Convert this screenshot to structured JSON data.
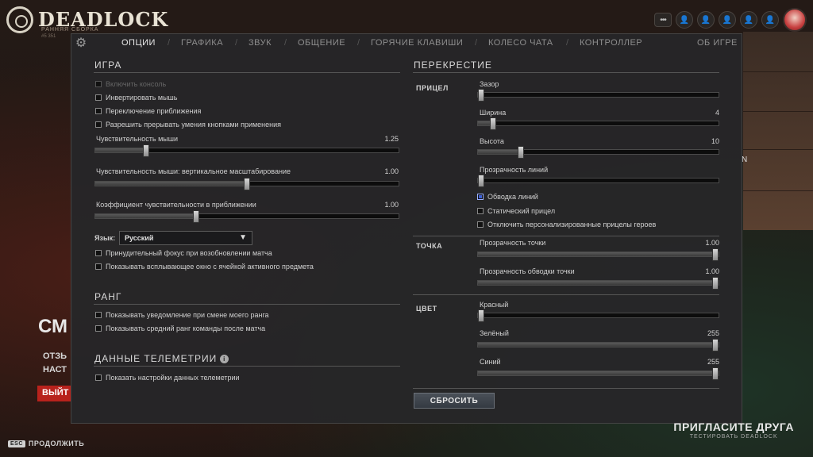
{
  "brand": {
    "name": "DEADLOCK",
    "subtitle": "РАННЯЯ СБОРКА",
    "version": "#5 351"
  },
  "topbar": {
    "menu_label": "•••"
  },
  "tabs": [
    {
      "label": "ОПЦИИ"
    },
    {
      "label": "ГРАФИКА"
    },
    {
      "label": "ЗВУК"
    },
    {
      "label": "ОБЩЕНИЕ"
    },
    {
      "label": "ГОРЯЧИЕ КЛАВИШИ"
    },
    {
      "label": "КОЛЕСО ЧАТА"
    },
    {
      "label": "КОНТРОЛЛЕР"
    },
    {
      "label": "ОБ ИГРЕ"
    }
  ],
  "game": {
    "title": "ИГРА",
    "checkboxes": [
      {
        "label": "Включить консоль",
        "checked": false
      },
      {
        "label": "Инвертировать мышь",
        "checked": false
      },
      {
        "label": "Переключение приближения",
        "checked": false
      },
      {
        "label": "Разрешить прерывать умения кнопками применения",
        "checked": false
      }
    ],
    "sliders": [
      {
        "label": "Чувствительность мыши",
        "value": "1.25",
        "fraction": 0.16
      },
      {
        "label": "Чувствительность мыши: вертикальное масштабирование",
        "value": "1.00",
        "fraction": 0.5
      },
      {
        "label": "Коэффициент чувствительности в приближении",
        "value": "1.00",
        "fraction": 0.33
      }
    ],
    "language_label": "Язык:",
    "language_value": "Русский",
    "checkboxes2": [
      {
        "label": "Принудительный фокус при возобновлении матча",
        "checked": false
      },
      {
        "label": "Показывать всплывающее окно с ячейкой активного предмета",
        "checked": false
      }
    ]
  },
  "rank": {
    "title": "РАНГ",
    "checkboxes": [
      {
        "label": "Показывать уведомление при смене моего ранга",
        "checked": false
      },
      {
        "label": "Показывать средний ранг команды после матча",
        "checked": false
      }
    ]
  },
  "telemetry": {
    "title": "ДАННЫЕ ТЕЛЕМЕТРИИ",
    "info_glyph": "i",
    "checkboxes": [
      {
        "label": "Показать настройки данных телеметрии",
        "checked": false
      }
    ]
  },
  "crosshair": {
    "title": "ПЕРЕКРЕСТИЕ",
    "reticle_label": "ПРИЦЕЛ",
    "reticle_sliders": [
      {
        "label": "Зазор",
        "value": "",
        "fraction": 0.0
      },
      {
        "label": "Ширина",
        "value": "4",
        "fraction": 0.05
      },
      {
        "label": "Высота",
        "value": "10",
        "fraction": 0.17
      },
      {
        "label": "Прозрачность линий",
        "value": "",
        "fraction": 0.0
      }
    ],
    "reticle_checkboxes": [
      {
        "label": "Обводка линий",
        "checked": true
      },
      {
        "label": "Статический прицел",
        "checked": false
      },
      {
        "label": "Отключить персонализированные прицелы героев",
        "checked": false
      }
    ],
    "dot_label": "ТОЧКА",
    "dot_sliders": [
      {
        "label": "Прозрачность точки",
        "value": "1.00",
        "fraction": 1.0
      },
      {
        "label": "Прозрачность обводки точки",
        "value": "1.00",
        "fraction": 1.0
      }
    ],
    "color_label": "ЦВЕТ",
    "color_sliders": [
      {
        "label": "Красный",
        "value": "",
        "fraction": 0.0
      },
      {
        "label": "Зелёный",
        "value": "255",
        "fraction": 1.0
      },
      {
        "label": "Синий",
        "value": "255",
        "fraction": 1.0
      }
    ],
    "reset_label": "СБРОСИТЬ"
  },
  "background": {
    "big_text": "СМ",
    "line1": "ОТЗЬ",
    "line2": "НАСТ",
    "red_button": "ВЫЙТ",
    "side_letter": "N",
    "esc_key": "ESC",
    "esc_label": "ПРОДОЛЖИТЬ",
    "invite_title": "ПРИГЛАСИТЕ ДРУГА",
    "invite_sub": "ТЕСТИРОВАТЬ DEADLOCK"
  }
}
